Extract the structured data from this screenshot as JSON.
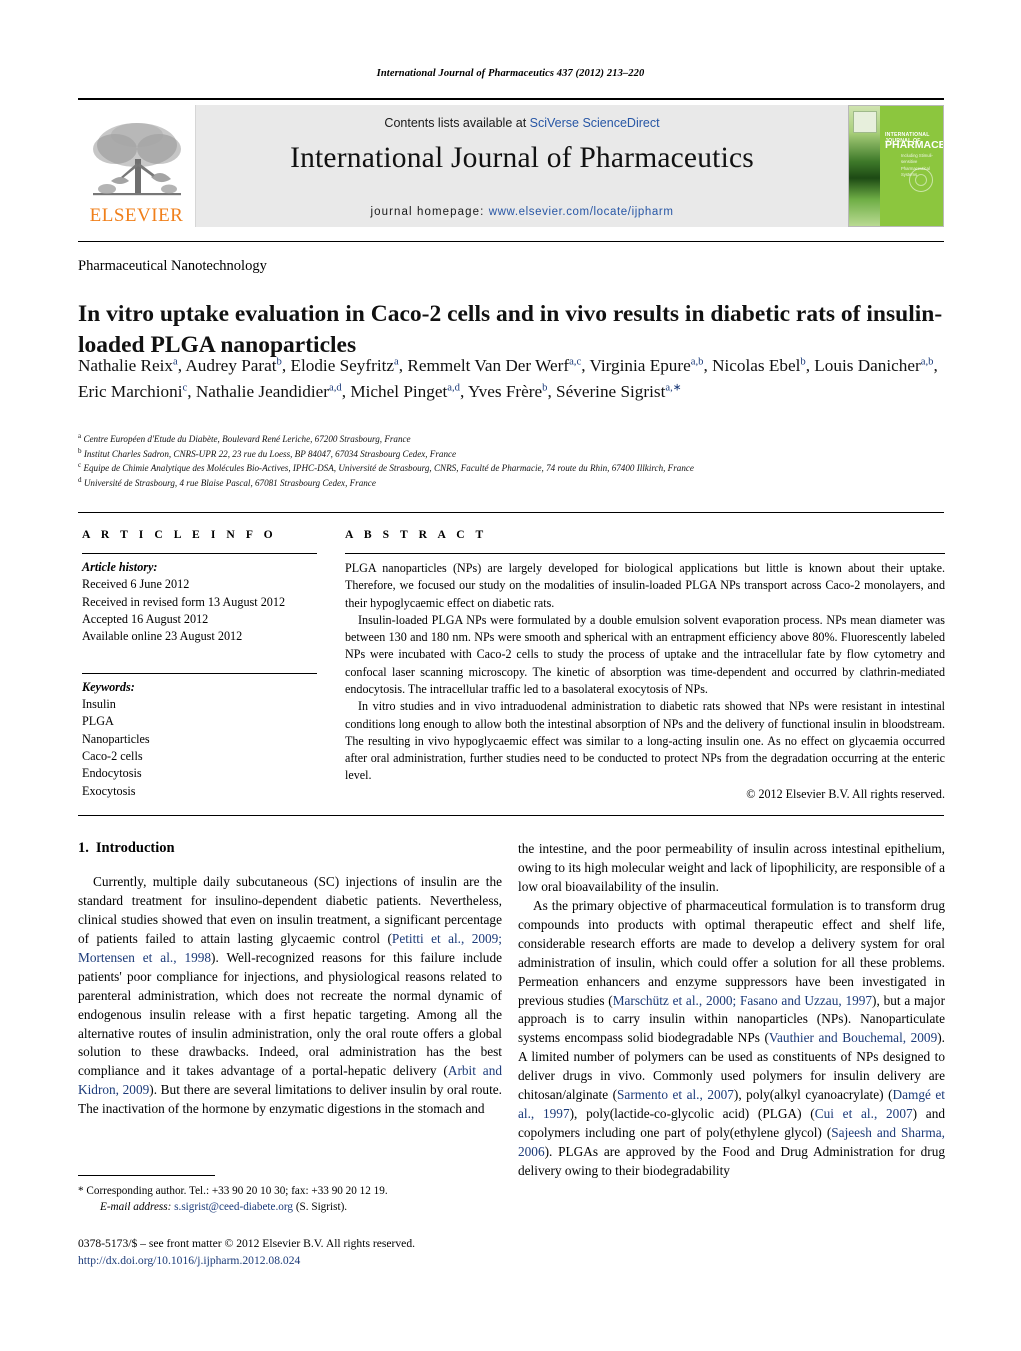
{
  "running_head": "International Journal of Pharmaceutics 437 (2012) 213–220",
  "masthead": {
    "publisher_logo_label": "ELSEVIER",
    "contents_prefix": "Contents lists available at ",
    "contents_link": "SciVerse ScienceDirect",
    "journal_title": "International Journal of Pharmaceutics",
    "homepage_prefix": "journal homepage: ",
    "homepage_url": "www.elsevier.com/locate/ijpharm",
    "cover": {
      "line1": "INTERNATIONAL JOURNAL OF",
      "line2": "PHARMACEUTICS",
      "line3": "Including\nStimuli-sensitive\nPharmaceutical Systems"
    }
  },
  "article": {
    "type": "Pharmaceutical Nanotechnology",
    "title": "In vitro uptake evaluation in Caco-2 cells and in vivo results in diabetic rats of insulin-loaded PLGA nanoparticles",
    "authors_html": "Nathalie Reix<sup>a</sup>, Audrey Parat<sup>b</sup>, Elodie Seyfritz<sup>a</sup>, Remmelt Van Der Werf<sup>a,c</sup>, Virginia Epure<sup>a,b</sup>, Nicolas Ebel<sup>b</sup>, Louis Danicher<sup>a,b</sup>, Eric Marchioni<sup>c</sup>, Nathalie Jeandidier<sup>a,d</sup>, Michel Pinget<sup>a,d</sup>, Yves Frère<sup>b</sup>, Séverine Sigrist<sup>a,∗</sup>",
    "affiliations": [
      {
        "mark": "a",
        "text": "Centre Européen d'Etude du Diabète, Boulevard René Leriche, 67200 Strasbourg, France"
      },
      {
        "mark": "b",
        "text": "Institut Charles Sadron, CNRS-UPR 22, 23 rue du Loess, BP 84047, 67034 Strasbourg Cedex, France"
      },
      {
        "mark": "c",
        "text": "Equipe de Chimie Analytique des Molécules Bio-Actives, IPHC-DSA, Université de Strasbourg, CNRS, Faculté de Pharmacie, 74 route du Rhin, 67400 Illkirch, France"
      },
      {
        "mark": "d",
        "text": "Université de Strasbourg, 4 rue Blaise Pascal, 67081 Strasbourg Cedex, France"
      }
    ]
  },
  "article_info": {
    "heading": "A R T I C L E    I N F O",
    "history_label": "Article history:",
    "history": [
      "Received 6 June 2012",
      "Received in revised form 13 August 2012",
      "Accepted 16 August 2012",
      "Available online 23 August 2012"
    ],
    "keywords_label": "Keywords:",
    "keywords": [
      "Insulin",
      "PLGA",
      "Nanoparticles",
      "Caco-2 cells",
      "Endocytosis",
      "Exocytosis"
    ]
  },
  "abstract": {
    "heading": "A B S T R A C T",
    "paragraphs": [
      "PLGA nanoparticles (NPs) are largely developed for biological applications but little is known about their uptake. Therefore, we focused our study on the modalities of insulin-loaded PLGA NPs transport across Caco-2 monolayers, and their hypoglycaemic effect on diabetic rats.",
      "Insulin-loaded PLGA NPs were formulated by a double emulsion solvent evaporation process. NPs mean diameter was between 130 and 180 nm. NPs were smooth and spherical with an entrapment efficiency above 80%. Fluorescently labeled NPs were incubated with Caco-2 cells to study the process of uptake and the intracellular fate by flow cytometry and confocal laser scanning microscopy. The kinetic of absorption was time-dependent and occurred by clathrin-mediated endocytosis. The intracellular traffic led to a basolateral exocytosis of NPs.",
      "In vitro studies and in vivo intraduodenal administration to diabetic rats showed that NPs were resistant in intestinal conditions long enough to allow both the intestinal absorption of NPs and the delivery of functional insulin in bloodstream. The resulting in vivo hypoglycaemic effect was similar to a long-acting insulin one. As no effect on glycaemia occurred after oral administration, further studies need to be conducted to protect NPs from the degradation occurring at the enteric level."
    ],
    "copyright": "© 2012 Elsevier B.V. All rights reserved."
  },
  "body": {
    "section_number": "1.",
    "section_title": "Introduction",
    "left_column_html": "Currently, multiple daily subcutaneous (SC) injections of insulin are the standard treatment for insulino-dependent diabetic patients. Nevertheless, clinical studies showed that even on insulin treatment, a significant percentage of patients failed to attain lasting glycaemic control (<span class=\"cite\">Petitti et al., 2009; Mortensen et al., 1998</span>). Well-recognized reasons for this failure include patients' poor compliance for injections, and physiological reasons related to parenteral administration, which does not recreate the normal dynamic of endogenous insulin release with a first hepatic targeting. Among all the alternative routes of insulin administration, only the oral route offers a global solution to these drawbacks. Indeed, oral administration has the best compliance and it takes advantage of a portal-hepatic delivery (<span class=\"cite\">Arbit and Kidron, 2009</span>). But there are several limitations to deliver insulin by oral route. The inactivation of the hormone by enzymatic digestions in the stomach and",
    "right_column_html_1": "the intestine, and the poor permeability of insulin across intestinal epithelium, owing to its high molecular weight and lack of lipophilicity, are responsible of a low oral bioavailability of the insulin.",
    "right_column_html_2": "As the primary objective of pharmaceutical formulation is to transform drug compounds into products with optimal therapeutic effect and shelf life, considerable research efforts are made to develop a delivery system for oral administration of insulin, which could offer a solution for all these problems. Permeation enhancers and enzyme suppressors have been investigated in previous studies (<span class=\"cite\">Marschütz et al., 2000; Fasano and Uzzau, 1997</span>), but a major approach is to carry insulin within nanoparticles (NPs). Nanoparticulate systems encompass solid biodegradable NPs (<span class=\"cite\">Vauthier and Bouchemal, 2009</span>). A limited number of polymers can be used as constituents of NPs designed to deliver drugs in vivo. Commonly used polymers for insulin delivery are chitosan/alginate (<span class=\"cite\">Sarmento et al., 2007</span>), poly(alkyl cyanoacrylate) (<span class=\"cite\">Damgé et al., 1997</span>), poly(lactide-co-glycolic acid) (PLGA) (<span class=\"cite\">Cui et al., 2007</span>) and copolymers including one part of poly(ethylene glycol) (<span class=\"cite\">Sajeesh and Sharma, 2006</span>). PLGAs are approved by the Food and Drug Administration for drug delivery owing to their biodegradability"
  },
  "footnote": {
    "corresponding_html": "* Corresponding author. Tel.: +33 90 20 10 30; fax: +33 90 20 12 19.",
    "email_html": "<em>E-mail address:</em> <span class=\"email-link\">s.sigrist@ceed-diabete.org</span> (S. Sigrist).",
    "issn_line": "0378-5173/$ – see front matter © 2012 Elsevier B.V. All rights reserved.",
    "doi_line": "http://dx.doi.org/10.1016/j.ijpharm.2012.08.024"
  }
}
